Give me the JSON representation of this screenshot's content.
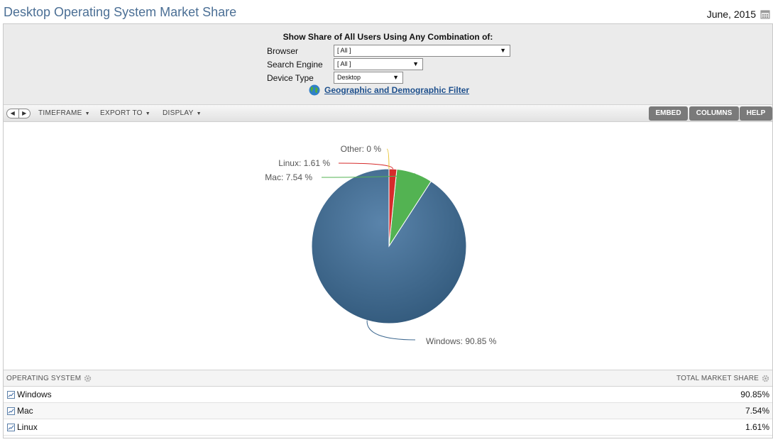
{
  "header": {
    "title": "Desktop Operating System Market Share",
    "date": "June, 2015",
    "calendar_icon": "calendar-icon"
  },
  "filters": {
    "heading": "Show Share of All Users Using Any Combination of:",
    "browser_label": "Browser",
    "browser_value": "[ All ]",
    "search_engine_label": "Search Engine",
    "search_engine_value": "[ All ]",
    "device_type_label": "Device Type",
    "device_type_value": "Desktop",
    "geo_link": "Geographic and Demographic Filter",
    "geo_icon": "globe-icon"
  },
  "toolbar": {
    "timeframe": "TIMEFRAME",
    "export": "EXPORT TO",
    "display": "DISPLAY",
    "embed": "EMBED",
    "columns": "COLUMNS",
    "help": "HELP"
  },
  "chart_data": {
    "type": "pie",
    "slices": [
      {
        "name": "Windows",
        "value": 90.85,
        "label": "Windows: 90.85 %",
        "color": "#3f6a91"
      },
      {
        "name": "Mac",
        "value": 7.54,
        "label": "Mac: 7.54 %",
        "color": "#53b352"
      },
      {
        "name": "Linux",
        "value": 1.61,
        "label": "Linux: 1.61 %",
        "color": "#d62b2b"
      },
      {
        "name": "Other",
        "value": 0,
        "label": "Other: 0 %",
        "color": "#e8c22c"
      }
    ]
  },
  "table": {
    "col_os": "OPERATING SYSTEM",
    "col_share": "TOTAL MARKET SHARE",
    "rows": [
      {
        "name": "Windows",
        "value": "90.85%"
      },
      {
        "name": "Mac",
        "value": "7.54%"
      },
      {
        "name": "Linux",
        "value": "1.61%"
      }
    ]
  }
}
